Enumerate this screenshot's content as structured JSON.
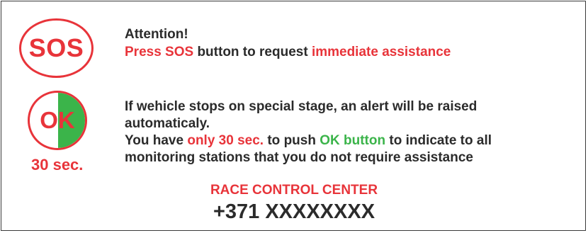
{
  "sos_badge": {
    "label": "SOS"
  },
  "ok_badge": {
    "label": "OK",
    "timer": "30 sec."
  },
  "sos_message": {
    "heading": "Attention!",
    "parts": [
      "Press SOS",
      " button to request ",
      "immediate assistance"
    ]
  },
  "ok_message": {
    "line1": "If wehicle stops on special stage, an alert will be raised",
    "line2": "automaticaly.",
    "line3_parts": [
      "You have ",
      "only 30 sec.",
      " to push ",
      "OK button",
      " to indicate to all"
    ],
    "line4": "monitoring stations that you do not require assistance"
  },
  "contact": {
    "title": "RACE CONTROL CENTER",
    "phone": "+371 XXXXXXXX"
  },
  "colors": {
    "red": "#e8343a",
    "green": "#3bb44a",
    "text": "#2b2b2b"
  }
}
